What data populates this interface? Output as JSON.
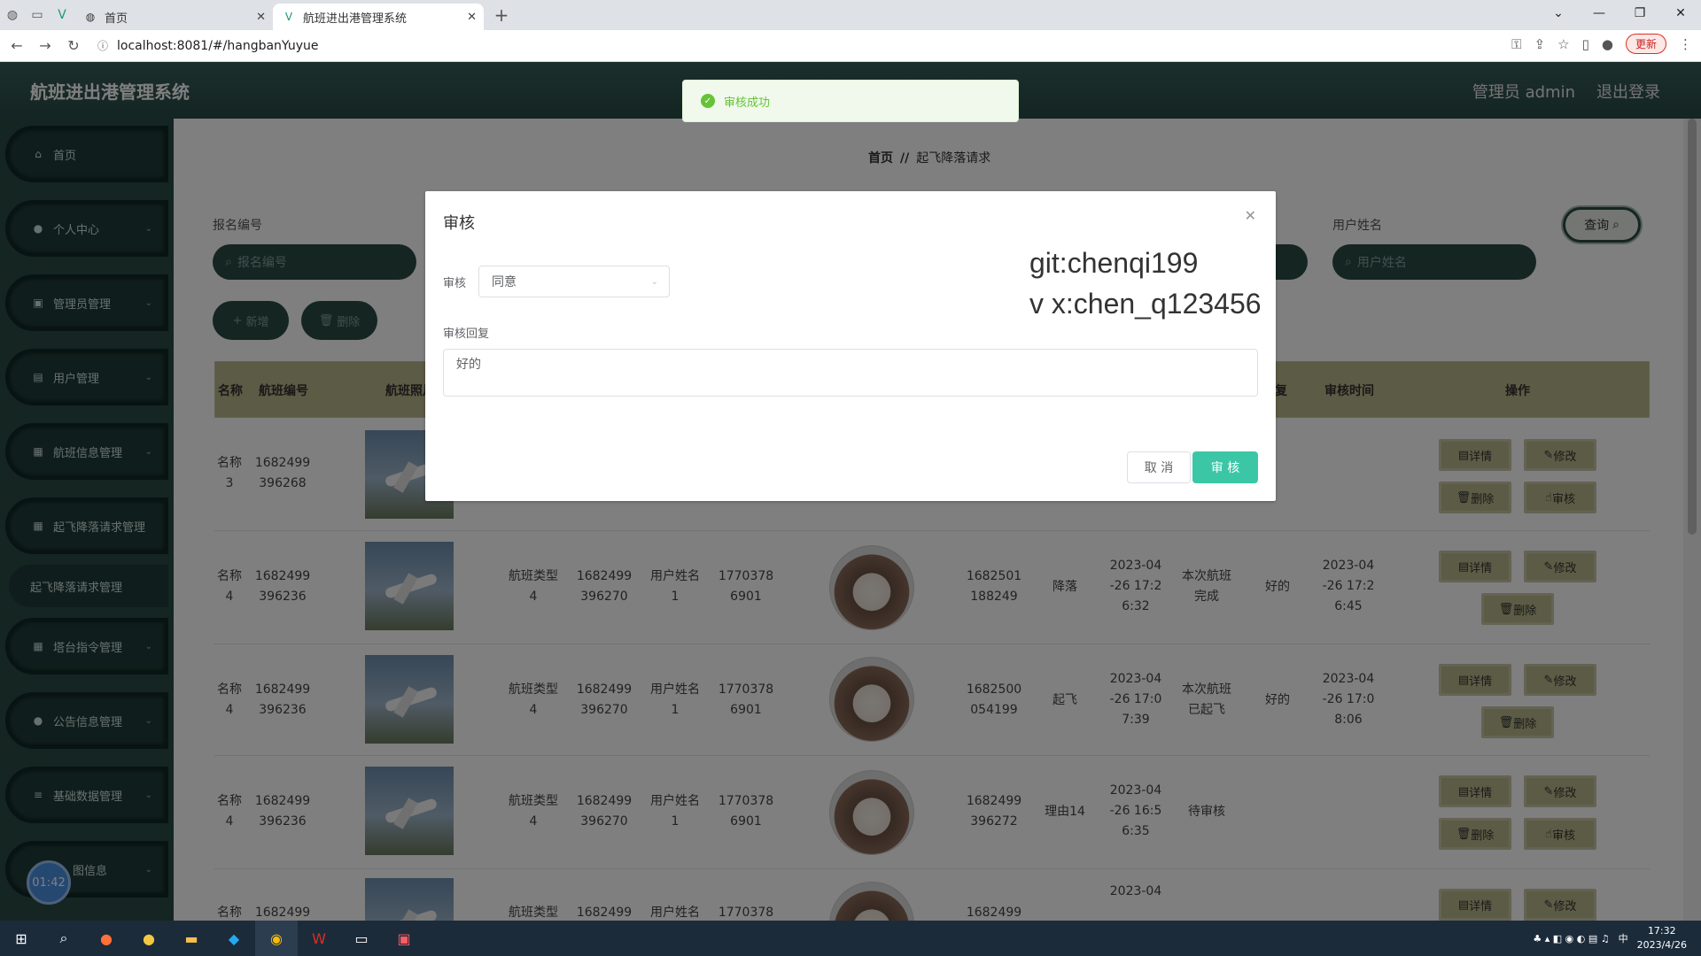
{
  "browser": {
    "tabs": [
      {
        "title": "首页",
        "active": false
      },
      {
        "title": "航班进出港管理系统",
        "active": true
      }
    ],
    "url": "localhost:8081/#/hangbanYuyue",
    "update_label": "更新"
  },
  "app": {
    "title": "航班进出港管理系统",
    "user_label": "管理员 admin",
    "logout_label": "退出登录"
  },
  "sidebar": {
    "items": [
      {
        "label": "首页",
        "icon": "home-icon"
      },
      {
        "label": "个人中心",
        "icon": "user-icon"
      },
      {
        "label": "管理员管理",
        "icon": "admin-icon"
      },
      {
        "label": "用户管理",
        "icon": "users-icon"
      },
      {
        "label": "航班信息管理",
        "icon": "flight-icon"
      },
      {
        "label": "起飞降落请求管理",
        "icon": "grid-icon"
      },
      {
        "label": "塔台指令管理",
        "icon": "grid-icon"
      },
      {
        "label": "公告信息管理",
        "icon": "pin-icon"
      },
      {
        "label": "基础数据管理",
        "icon": "list-icon"
      },
      {
        "label": "图信息",
        "icon": "image-icon"
      }
    ],
    "sub_item": "起飞降落请求管理",
    "timer": "01:42"
  },
  "breadcrumb": {
    "home": "首页",
    "sep": "//",
    "current": "起飞降落请求"
  },
  "search": {
    "label1": "报名编号",
    "placeholder1": "报名编号",
    "label2": "用户姓名",
    "placeholder2": "用户姓名",
    "query_label": "查询"
  },
  "actions": {
    "add_label": "新增",
    "delete_label": "删除"
  },
  "table": {
    "headers": [
      "名称",
      "航班编号",
      "航班照片",
      "回复",
      "审核时间",
      "操作"
    ],
    "rows": [
      {
        "name": "名称\n3",
        "flight_no": "1682499\n396268",
        "review_time": "",
        "ops": [
          "详情",
          "修改",
          "删除",
          "审核"
        ]
      },
      {
        "name": "名称\n4",
        "flight_no": "1682499\n396236",
        "type": "航班类型\n4",
        "type_no": "1682499\n396270",
        "user": "用户姓名\n1",
        "phone": "1770378\n6901",
        "req_no": "1682501\n188249",
        "action": "降落",
        "time": "2023-04\n-26 17:2\n6:32",
        "reason": "本次航班\n完成",
        "reply": "好的",
        "review_time": "2023-04\n-26 17:2\n6:45",
        "ops": [
          "详情",
          "修改",
          "删除"
        ]
      },
      {
        "name": "名称\n4",
        "flight_no": "1682499\n396236",
        "type": "航班类型\n4",
        "type_no": "1682499\n396270",
        "user": "用户姓名\n1",
        "phone": "1770378\n6901",
        "req_no": "1682500\n054199",
        "action": "起飞",
        "time": "2023-04\n-26 17:0\n7:39",
        "reason": "本次航班\n已起飞",
        "reply": "好的",
        "review_time": "2023-04\n-26 17:0\n8:06",
        "ops": [
          "详情",
          "修改",
          "删除"
        ]
      },
      {
        "name": "名称\n4",
        "flight_no": "1682499\n396236",
        "type": "航班类型\n4",
        "type_no": "1682499\n396270",
        "user": "用户姓名\n1",
        "phone": "1770378\n6901",
        "req_no": "1682499\n396272",
        "action": "理由14",
        "time": "2023-04\n-26 16:5\n6:35",
        "reason": "待审核",
        "reply": "",
        "review_time": "",
        "ops": [
          "详情",
          "修改",
          "删除",
          "审核"
        ]
      },
      {
        "name": "名称",
        "flight_no": "1682499",
        "type": "航班类型",
        "type_no": "1682499",
        "user": "用户姓名",
        "phone": "1770378",
        "req_no": "1682499",
        "time": "2023-04",
        "ops": [
          "详情",
          "修改"
        ]
      }
    ]
  },
  "message": {
    "text": "审核成功",
    "color": "#67c23a"
  },
  "dialog": {
    "title": "审核",
    "watermark_line1": "git:chenqi199",
    "watermark_line2": "v x:chen_q123456",
    "field_label": "审核",
    "select_value": "同意",
    "reply_label": "审核回复",
    "reply_value": "好的",
    "cancel_label": "取 消",
    "confirm_label": "审 核",
    "accent": "#3bc7a6"
  },
  "taskbar": {
    "time": "17:32",
    "date": "2023/4/26",
    "ime": "中"
  }
}
